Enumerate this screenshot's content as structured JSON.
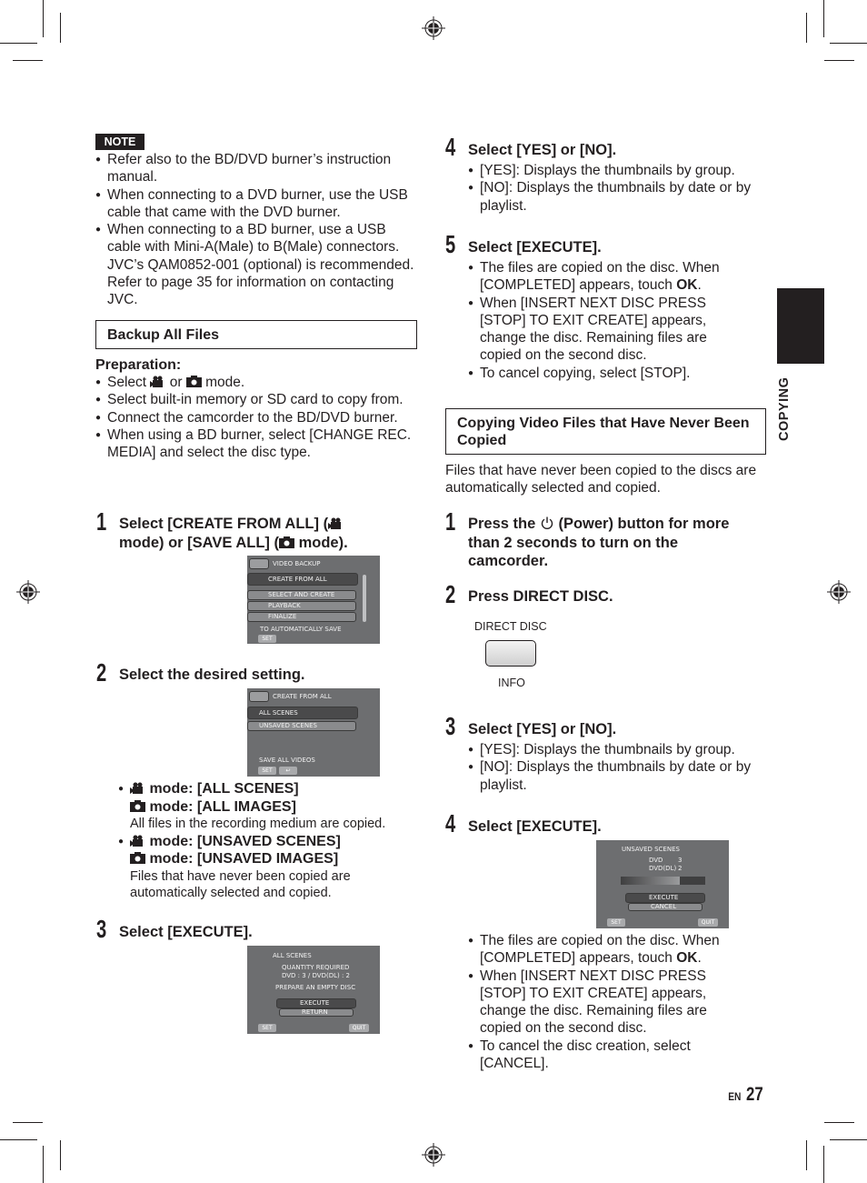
{
  "note": {
    "badge": "NOTE",
    "items": [
      "Refer also to the BD/DVD burner’s instruction manual.",
      "When connecting to a DVD burner, use the USB cable that came with the DVD burner.",
      "When connecting to a BD burner, use a USB cable with Mini-A(Male) to B(Male) connectors. JVC’s QAM0852-001 (optional) is recommended. Refer to page 35 for information on contacting JVC."
    ]
  },
  "backup": {
    "title": "Backup All Files",
    "preparation_label": "Preparation:",
    "prep_items": [
      {
        "pre": "Select ",
        "mid": " or ",
        "post": " mode."
      },
      "Select built-in memory or SD card to copy from.",
      "Connect the camcorder to the BD/DVD burner.",
      "When using a BD burner, select [CHANGE REC. MEDIA] and select the disc type."
    ],
    "steps": [
      {
        "num": "1",
        "text_a": "Select [CREATE FROM ALL] (",
        "text_b": "mode) or [SAVE ALL] (",
        "text_c": " mode)."
      },
      {
        "num": "2",
        "text": "Select the desired setting."
      },
      {
        "num": "3",
        "text": "Select [EXECUTE]."
      },
      {
        "num": "4",
        "text": "Select [YES] or [NO]."
      },
      {
        "num": "5",
        "text": "Select [EXECUTE]."
      }
    ],
    "screen1": {
      "header": "VIDEO BACKUP",
      "items": [
        "CREATE FROM ALL",
        "SELECT AND CREATE",
        "PLAYBACK",
        "FINALIZE"
      ],
      "footer": "TO AUTOMATICALLY SAVE",
      "set": "SET"
    },
    "screen2": {
      "header": "CREATE FROM ALL",
      "items": [
        "ALL SCENES",
        "UNSAVED SCENES"
      ],
      "footer": "SAVE ALL VIDEOS",
      "set": "SET",
      "back": "↩"
    },
    "setting_options": [
      {
        "video_mode": "mode: [ALL SCENES]",
        "photo_mode": "mode: [ALL IMAGES]",
        "desc": "All files in the recording medium are copied."
      },
      {
        "video_mode": "mode: [UNSAVED SCENES]",
        "photo_mode": "mode: [UNSAVED IMAGES]",
        "desc": "Files that have never been copied are automatically selected and copied."
      }
    ],
    "screen3": {
      "title": "ALL SCENES",
      "line1": "QUANTITY REQUIRED",
      "line2": "DVD : 3 / DVD(DL) : 2",
      "line3": "PREPARE AN EMPTY DISC",
      "execute": "EXECUTE",
      "return": "RETURN",
      "set": "SET",
      "quit": "QUIT"
    },
    "step4_bullets": [
      "[YES]: Displays the thumbnails by group.",
      "[NO]: Displays the thumbnails by date or by playlist."
    ],
    "step5_bullets": [
      {
        "pre": "The files are copied on the disc. When [COMPLETED] appears, touch ",
        "bold": "OK",
        "post": "."
      },
      "When [INSERT NEXT DISC PRESS [STOP] TO EXIT CREATE] appears, change the disc. Remaining files are copied on the second disc.",
      "To cancel copying, select [STOP]."
    ]
  },
  "never_copied": {
    "title": "Copying Video Files that Have Never Been Copied",
    "intro": "Files that have never been copied to the discs are automatically selected and copied.",
    "steps": [
      {
        "num": "1",
        "text_a": "Press the ",
        "text_b": " (Power) button for more than 2 seconds to turn on the camcorder."
      },
      {
        "num": "2",
        "text": "Press DIRECT DISC."
      },
      {
        "num": "3",
        "text": "Select [YES] or [NO]."
      },
      {
        "num": "4",
        "text": "Select [EXECUTE]."
      }
    ],
    "button_diagram": {
      "top_label": "DIRECT DISC",
      "bottom_label": "INFO"
    },
    "step3_bullets": [
      "[YES]: Displays the thumbnails by group.",
      "[NO]: Displays the thumbnails by date or by playlist."
    ],
    "screen4": {
      "title": "UNSAVED SCENES",
      "dvd_label": "DVD",
      "dvd_value": "3",
      "dvddl_label": "DVD(DL)",
      "dvddl_value": "2",
      "execute": "EXECUTE",
      "cancel": "CANCEL",
      "set": "SET",
      "quit": "QUIT"
    },
    "step4_bullets": [
      {
        "pre": "The files are copied on the disc. When [COMPLETED] appears, touch ",
        "bold": "OK",
        "post": "."
      },
      "When [INSERT NEXT DISC PRESS [STOP] TO EXIT CREATE] appears, change the disc. Remaining files are copied on the second disc.",
      "To cancel the disc creation, select [CANCEL]."
    ]
  },
  "side_tab": {
    "label": "COPYING"
  },
  "footer": {
    "lang": "EN",
    "page": "27"
  },
  "icons": {
    "video": "video-camera-icon",
    "photo": "still-camera-icon",
    "power": "power-icon",
    "registration": "registration-mark-icon"
  }
}
